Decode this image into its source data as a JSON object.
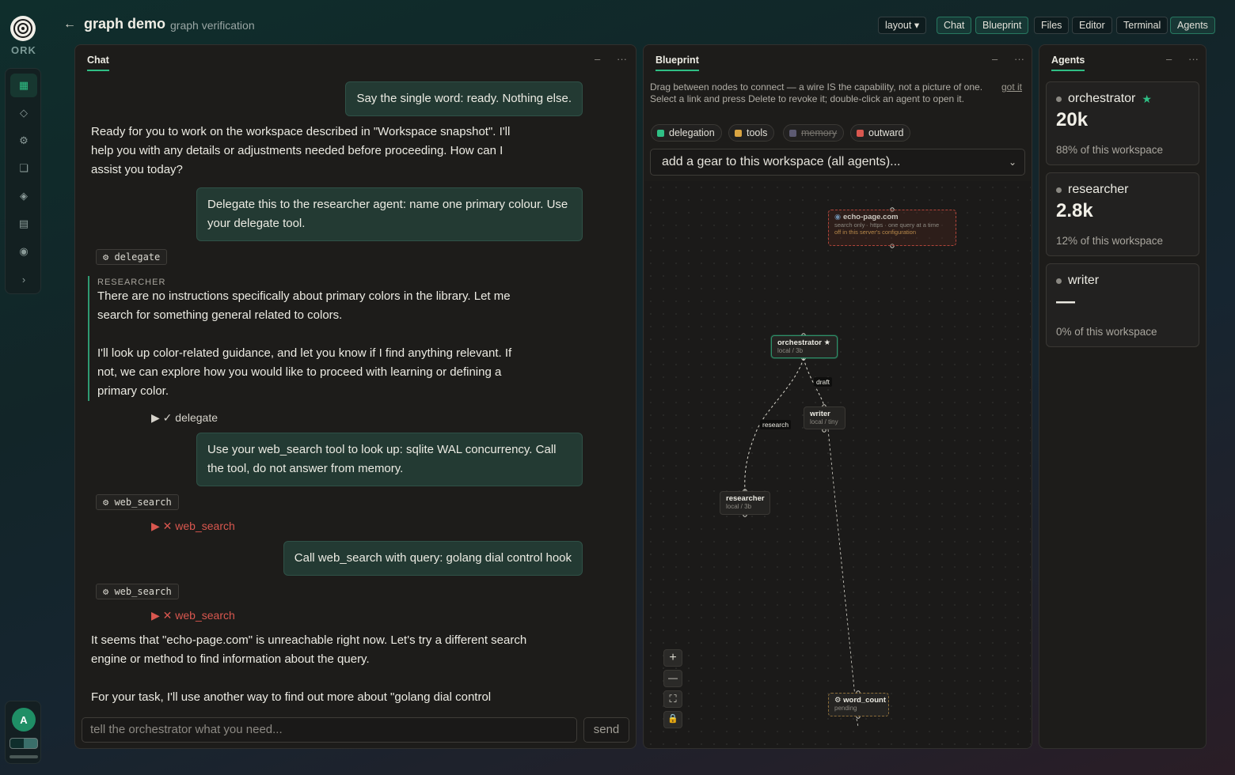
{
  "app": {
    "title": "graph demo",
    "subtitle": "graph verification",
    "logo_word": "ORK"
  },
  "topbar": {
    "layout_label": "layout ▾",
    "buttons": [
      "Chat",
      "Blueprint",
      "Files",
      "Editor",
      "Terminal",
      "Agents"
    ]
  },
  "rail": {
    "icons": [
      "grid-icon",
      "diamond-icon",
      "gear-icon",
      "square-icon",
      "node-icon",
      "list-icon",
      "circle-icon",
      "chevron-right-icon"
    ],
    "avatar": "A"
  },
  "chat": {
    "title": "Chat",
    "minimize": "–",
    "more": "···",
    "messages": {
      "u1": "Say the single word: ready. Nothing else.",
      "a1": "Ready for you to work on the workspace described in \"Workspace snapshot\". I'll help you with any details or adjustments needed before proceeding. How can I assist you today?",
      "u2": "Delegate this to the researcher agent: name one primary colour. Use your delegate tool.",
      "tool1": "⚙ delegate",
      "researcher_label": "RESEARCHER",
      "r1": "There are no instructions specifically about primary colors in the library. Let me search for something general related to colors.",
      "r2": "I'll look up color-related guidance, and let you know if I find anything relevant. If not, we can explore how you would like to proceed with learning or defining a primary color.",
      "result1": "▶ ✓ delegate",
      "u3": "Use your web_search tool to look up: sqlite WAL concurrency. Call the tool, do not answer from memory.",
      "tool2": "⚙ web_search",
      "result2": "▶ ✕ web_search",
      "u4": "Call web_search with query: golang dial control hook",
      "tool3": "⚙ web_search",
      "result3": "▶ ✕ web_search",
      "a2": "It seems that \"echo-page.com\" is unreachable right now. Let's try a different search engine or method to find information about the query.",
      "a3": "For your task, I'll use another way to find out more about \"golang dial control"
    },
    "input_placeholder": "tell the orchestrator what you need...",
    "send_label": "send"
  },
  "blueprint": {
    "title": "Blueprint",
    "minimize": "–",
    "more": "···",
    "help": "Drag between nodes to connect — a wire IS the capability, not a picture of one. Select a link and press Delete to revoke it; double-click an agent to open it.",
    "got_it": "got it",
    "legend": [
      {
        "label": "delegation",
        "color": "#2fbf85",
        "struck": false
      },
      {
        "label": "tools",
        "color": "#d9a441",
        "struck": false
      },
      {
        "label": "memory",
        "color": "#5c5a72",
        "struck": true
      },
      {
        "label": "outward",
        "color": "#d9574f",
        "struck": false
      }
    ],
    "gear_select": "add a gear to this workspace (all agents)...",
    "nodes": {
      "echo": {
        "name": "echo-page.com",
        "sub1": "search only · https · one query at a time",
        "sub2": "off in this server's configuration"
      },
      "orchestrator": {
        "name": "orchestrator ★",
        "sub": "local / 3b"
      },
      "writer": {
        "name": "writer",
        "sub": "local / tiny"
      },
      "researcher": {
        "name": "researcher",
        "sub": "local / 3b"
      },
      "word_count": {
        "name": "⚙ word_count",
        "sub": "pending"
      }
    },
    "edge_labels": {
      "draft": "draft",
      "research": "research"
    },
    "zoom": {
      "in": "+",
      "out": "—",
      "fit": "⛶",
      "lock": "🔒"
    }
  },
  "agents": {
    "title": "Agents",
    "minimize": "–",
    "more": "···",
    "cards": [
      {
        "name": "orchestrator",
        "star": "★",
        "value": "20k",
        "share": "88% of this workspace"
      },
      {
        "name": "researcher",
        "star": "",
        "value": "2.8k",
        "share": "12% of this workspace"
      },
      {
        "name": "writer",
        "star": "",
        "value": "—",
        "share": "0% of this workspace"
      }
    ]
  },
  "colors": {
    "accent": "#2fbf85",
    "error": "#d9574f",
    "panel": "#1d1c1a"
  }
}
